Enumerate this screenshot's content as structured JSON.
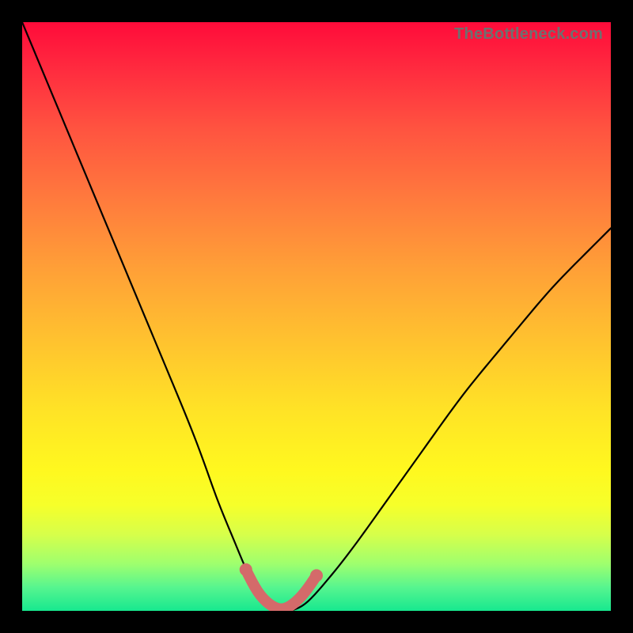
{
  "watermark": "TheBottleneck.com",
  "chart_data": {
    "type": "line",
    "title": "",
    "xlabel": "",
    "ylabel": "",
    "xlim": [
      0,
      100
    ],
    "ylim": [
      0,
      100
    ],
    "series": [
      {
        "name": "bottleneck-curve",
        "x": [
          0,
          5,
          10,
          15,
          20,
          25,
          30,
          33,
          36,
          38,
          40,
          42,
          44,
          46,
          48,
          50,
          55,
          60,
          65,
          70,
          75,
          80,
          85,
          90,
          95,
          100
        ],
        "values": [
          100,
          88,
          76,
          64,
          52,
          40,
          28,
          19,
          12,
          7,
          3,
          1,
          0,
          0,
          1,
          3,
          9,
          16,
          23,
          30,
          37,
          43,
          49,
          55,
          60,
          65
        ]
      }
    ],
    "highlight": {
      "name": "sweet-spot-band",
      "x": [
        38,
        40,
        42,
        44,
        46,
        48,
        50
      ],
      "values": [
        7,
        3,
        1,
        0,
        1,
        3,
        6
      ]
    },
    "colors": {
      "curve": "#000000",
      "highlight": "#d46a6a",
      "gradient_top": "#ff0b3a",
      "gradient_mid": "#ffe326",
      "gradient_bottom": "#17e88f",
      "frame": "#000000"
    }
  }
}
